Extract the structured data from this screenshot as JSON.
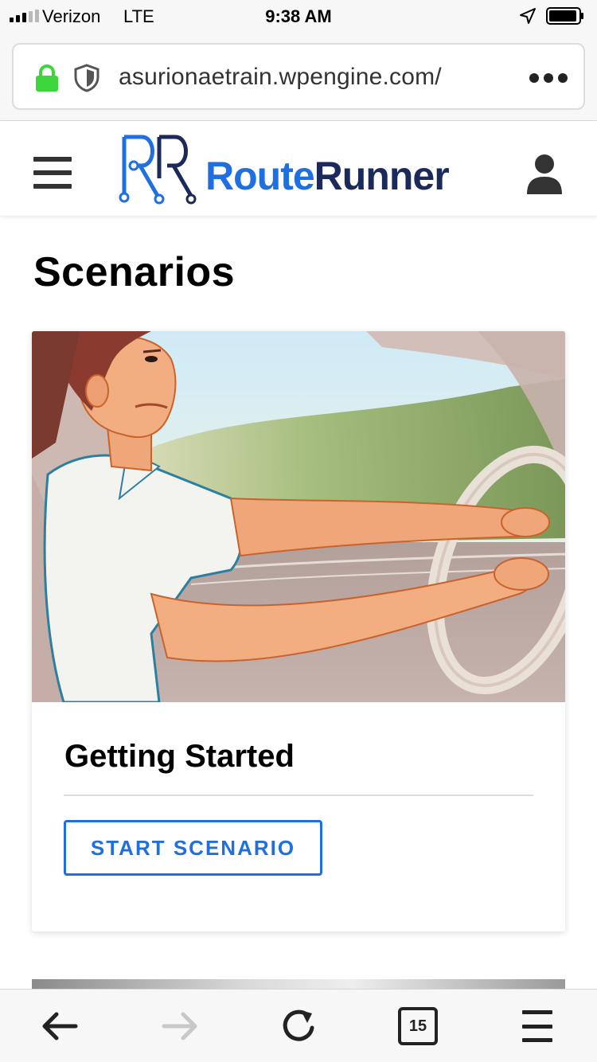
{
  "status_bar": {
    "carrier": "Verizon",
    "network": "LTE",
    "time": "9:38 AM",
    "signal_bars_active": 3,
    "signal_bars_total": 5
  },
  "browser": {
    "url": "asurionaetrain.wpengine.com/",
    "open_tabs": "15",
    "icons": {
      "lock": "lock-icon",
      "shield": "shield-icon",
      "more": "more-icon",
      "back": "back-arrow-icon",
      "forward": "forward-arrow-icon",
      "reload": "reload-icon",
      "tabs": "tabs-icon",
      "menu": "menu-icon"
    },
    "colors": {
      "lock": "#3cd63c"
    }
  },
  "header": {
    "logo_route": "Route",
    "logo_runner": "Runner",
    "icons": {
      "menu": "hamburger-icon",
      "user": "user-icon"
    },
    "colors": {
      "brand_blue": "#1f6fe0",
      "brand_navy": "#1b2a5a"
    }
  },
  "main": {
    "title": "Scenarios",
    "cards": [
      {
        "title": "Getting Started",
        "button_label": "START SCENARIO"
      }
    ]
  }
}
